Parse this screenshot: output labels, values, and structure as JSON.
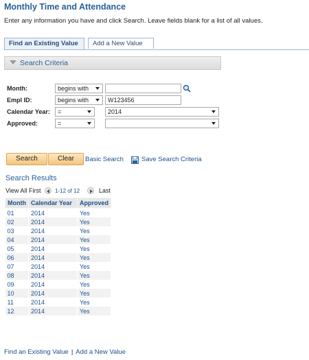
{
  "page": {
    "title": "Monthly Time and Attendance",
    "instructions": "Enter any information you have and click Search. Leave fields blank for a list of all values."
  },
  "tabs": [
    {
      "label": "Find an Existing Value",
      "active": true
    },
    {
      "label": "Add a New Value",
      "active": false
    }
  ],
  "criteria": {
    "header": "Search Criteria",
    "fields": [
      {
        "label": "Month:",
        "operator": "begins with",
        "value": ""
      },
      {
        "label": "Empl ID:",
        "operator": "begins with",
        "value": "W123456"
      },
      {
        "label": "Calendar Year:",
        "operator": "=",
        "value": "2014"
      },
      {
        "label": "Approved:",
        "operator": "=",
        "value": ""
      }
    ]
  },
  "actions": {
    "search": "Search",
    "clear": "Clear",
    "basic_search": "Basic Search",
    "save_criteria": "Save Search Criteria"
  },
  "results": {
    "title": "Search Results",
    "nav": {
      "view_all": "View All",
      "first": "First",
      "range": "1-12 of 12",
      "last": "Last"
    },
    "columns": [
      "Month",
      "Calendar Year",
      "Approved"
    ],
    "rows": [
      [
        "01",
        "2014",
        "Yes"
      ],
      [
        "02",
        "2014",
        "Yes"
      ],
      [
        "03",
        "2014",
        "Yes"
      ],
      [
        "04",
        "2014",
        "Yes"
      ],
      [
        "05",
        "2014",
        "Yes"
      ],
      [
        "06",
        "2014",
        "Yes"
      ],
      [
        "07",
        "2014",
        "Yes"
      ],
      [
        "08",
        "2014",
        "Yes"
      ],
      [
        "09",
        "2014",
        "Yes"
      ],
      [
        "10",
        "2014",
        "Yes"
      ],
      [
        "11",
        "2014",
        "Yes"
      ],
      [
        "12",
        "2014",
        "Yes"
      ]
    ]
  },
  "footer": {
    "find_existing": "Find an Existing Value",
    "add_new": "Add a New Value",
    "separator": "|"
  },
  "colors": {
    "accent": "#2a6099",
    "link": "#1d4f8b",
    "button_bg": "#f3c57c",
    "button_border": "#d9a553"
  }
}
